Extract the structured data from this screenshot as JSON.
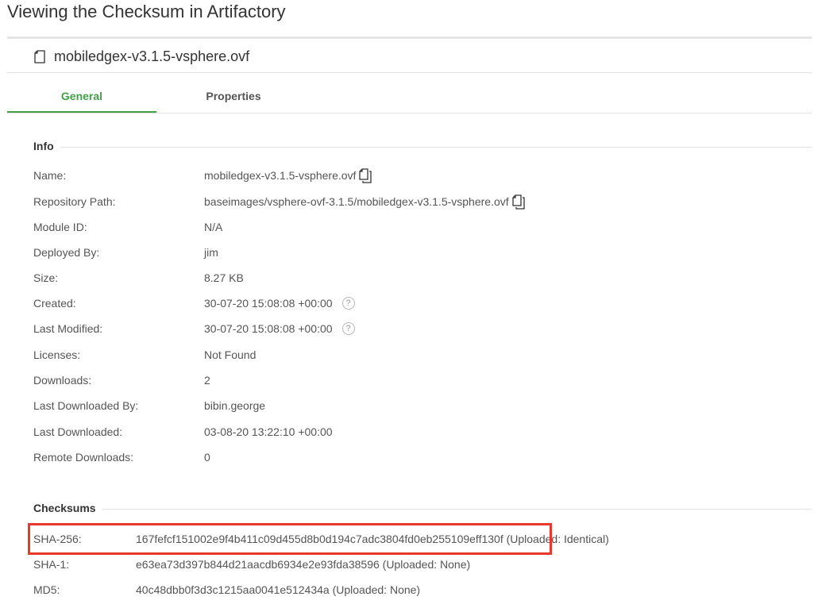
{
  "page": {
    "heading": "Viewing the Checksum in Artifactory"
  },
  "file": {
    "name": "mobiledgex-v3.1.5-vsphere.ovf",
    "icon": "file-icon"
  },
  "tabs": [
    {
      "label": "General",
      "active": true
    },
    {
      "label": "Properties",
      "active": false
    }
  ],
  "accent_color": "#43a047",
  "highlight_color": "#e8392a",
  "info": {
    "title": "Info",
    "rows": [
      {
        "label": "Name:",
        "value": "mobiledgex-v3.1.5-vsphere.ovf"
      },
      {
        "label": "Repository Path:",
        "value": "baseimages/vsphere-ovf-3.1.5/mobiledgex-v3.1.5-vsphere.ovf"
      },
      {
        "label": "Module ID:",
        "value": "N/A"
      },
      {
        "label": "Deployed By:",
        "value": "jim"
      },
      {
        "label": "Size:",
        "value": "8.27 KB"
      },
      {
        "label": "Created:",
        "value": "30-07-20 15:08:08 +00:00"
      },
      {
        "label": "Last Modified:",
        "value": "30-07-20 15:08:08 +00:00"
      },
      {
        "label": "Licenses:",
        "value": "Not Found"
      },
      {
        "label": "Downloads:",
        "value": "2"
      },
      {
        "label": "Last Downloaded By:",
        "value": "bibin.george"
      },
      {
        "label": "Last Downloaded:",
        "value": "03-08-20 13:22:10 +00:00"
      },
      {
        "label": "Remote Downloads:",
        "value": "0"
      }
    ],
    "help_glyph": "?"
  },
  "checksums": {
    "title": "Checksums",
    "rows": [
      {
        "label": "SHA-256:",
        "value": "167fefcf151002e9f4b411c09d455d8b0d194c7adc3804fd0eb255109eff130f (Uploaded: Identical)"
      },
      {
        "label": "SHA-1:",
        "value": "e63ea73d397b844d21aacdb6934e2e93fda38596 (Uploaded: None)"
      },
      {
        "label": "MD5:",
        "value": "40c48dbb0f3d3c1215aa0041e512434a (Uploaded: None)"
      }
    ]
  }
}
